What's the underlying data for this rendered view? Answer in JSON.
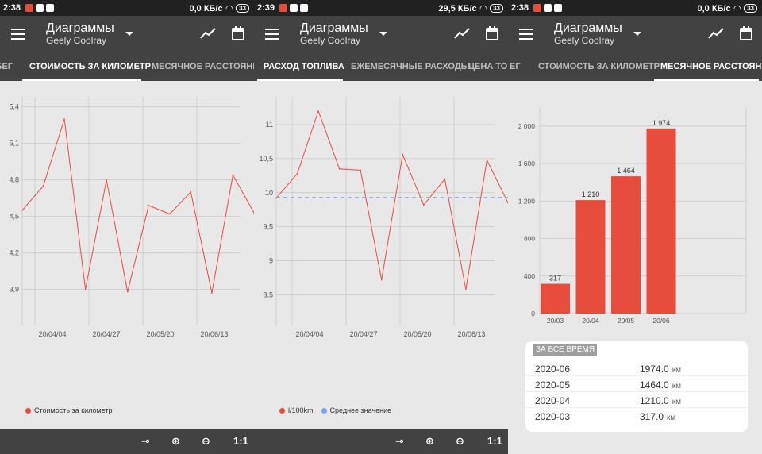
{
  "colors": {
    "series": "#e84c3d",
    "avg": "#7aa0f0",
    "grid": "#c8c8c8",
    "appbar": "#424242",
    "statusbar": "#212121"
  },
  "app": {
    "title": "Диаграммы",
    "subtitle": "Geely Coolray"
  },
  "panels": [
    {
      "status": {
        "time": "2:38",
        "speed": "0,0 КБ/с",
        "battery": "33"
      },
      "tabs": [
        {
          "label": "ОБЕГ",
          "active": false
        },
        {
          "label": "СТОИМОСТЬ ЗА КИЛОМЕТР",
          "active": true
        },
        {
          "label": "МЕСЯЧНОЕ РАССТОЯНИЕ",
          "active": false
        }
      ],
      "toolbar": {
        "zoom_reset": "1:1"
      }
    },
    {
      "status": {
        "time": "2:39",
        "speed": "29,5 КБ/с",
        "battery": "33"
      },
      "tabs": [
        {
          "label": "РАСХОД ТОПЛИВА",
          "active": true
        },
        {
          "label": "ЕЖЕМЕСЯЧНЫЕ РАСХОДЫ",
          "active": false
        },
        {
          "label": "ЦЕНА ТОПЛИВ",
          "active": false
        }
      ],
      "toolbar": {
        "zoom_reset": "1:1"
      }
    },
    {
      "status": {
        "time": "2:38",
        "speed": "0,0 КБ/с",
        "battery": "33"
      },
      "tabs": [
        {
          "label": "ЕГ",
          "active": false
        },
        {
          "label": "СТОИМОСТЬ ЗА КИЛОМЕТР",
          "active": false
        },
        {
          "label": "МЕСЯЧНОЕ РАССТОЯНИЕ",
          "active": true
        }
      ]
    }
  ],
  "chart_data": [
    {
      "type": "line",
      "yticks": [
        "3,9",
        "4,2",
        "4,5",
        "4,8",
        "5,1",
        "5,4"
      ],
      "ylim": [
        3.8,
        5.45
      ],
      "xticks": [
        "20/04/04",
        "20/04/27",
        "20/05/20",
        "20/06/13"
      ],
      "series": [
        {
          "name": "Стоимость за километр",
          "values": [
            4.55,
            4.75,
            5.3,
            3.9,
            4.8,
            3.88,
            4.59,
            4.52,
            4.7,
            3.87,
            4.84,
            4.53
          ]
        }
      ]
    },
    {
      "type": "line",
      "yticks": [
        "8,5",
        "9",
        "9,5",
        "10",
        "10,5",
        "11"
      ],
      "ylim": [
        8.4,
        11.35
      ],
      "xticks": [
        "20/04/04",
        "20/04/27",
        "20/05/20",
        "20/06/13"
      ],
      "series": [
        {
          "name": "l/100km",
          "values": [
            9.92,
            10.28,
            11.2,
            10.35,
            10.33,
            8.72,
            10.56,
            9.82,
            10.2,
            8.58,
            10.48,
            9.85
          ]
        },
        {
          "name": "Среднее значение",
          "values": [
            9.93
          ]
        }
      ]
    },
    {
      "type": "bar",
      "categories": [
        "20/03",
        "20/04",
        "20/05",
        "20/06"
      ],
      "values": [
        317,
        1210,
        1464,
        1974
      ],
      "value_labels": [
        "317",
        "1 210",
        "1 464",
        "1 974"
      ],
      "yticks": [
        "0",
        "400",
        "800",
        "1 200",
        "1 600",
        "2 000"
      ],
      "ylim": [
        0,
        2100
      ]
    }
  ],
  "summary": {
    "title": "ЗА ВСЕ ВРЕМЯ",
    "unit": "км",
    "rows": [
      {
        "month": "2020-06",
        "value": "1974.0"
      },
      {
        "month": "2020-05",
        "value": "1464.0"
      },
      {
        "month": "2020-04",
        "value": "1210.0"
      },
      {
        "month": "2020-03",
        "value": "317.0"
      }
    ]
  }
}
